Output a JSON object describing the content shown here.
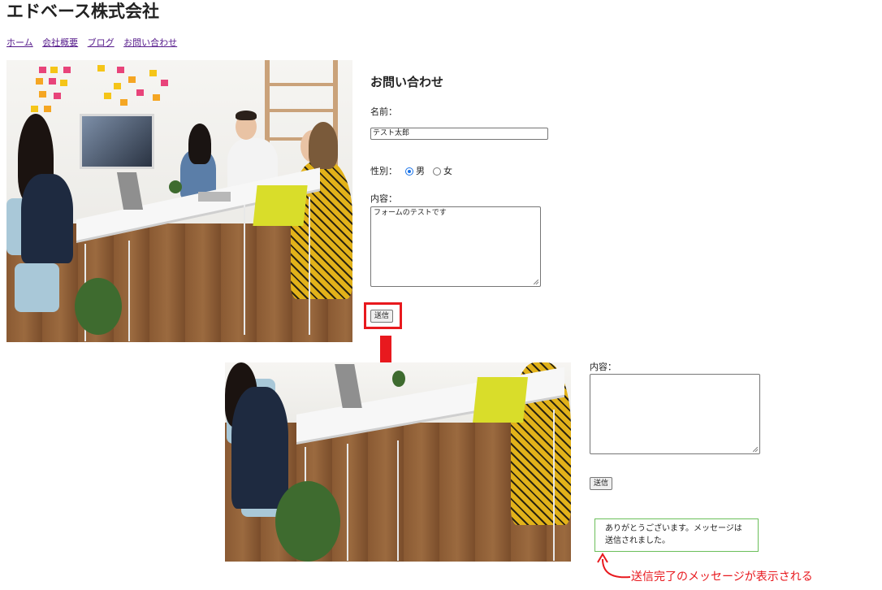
{
  "site": {
    "title": "エドベース株式会社",
    "nav": [
      "ホーム",
      "会社概要",
      "ブログ",
      "お問い合わせ"
    ]
  },
  "form": {
    "title": "お問い合わせ",
    "name_label": "名前：",
    "name_value": "テスト太郎",
    "gender_label": "性別：",
    "gender_options": [
      "男",
      "女"
    ],
    "gender_selected": "男",
    "content_label": "内容：",
    "content_value": "フォームのテストです",
    "submit_label": "送信"
  },
  "after": {
    "content_label": "内容：",
    "content_value": "",
    "submit_label": "送信",
    "success_message": "ありがとうございます。メッセージは送信されました。"
  },
  "annotation": {
    "text": "送信完了のメッセージが表示される",
    "color": "#e8191e"
  },
  "colors": {
    "highlight": "#e8191e",
    "success_border": "#6bbf5a",
    "link": "#551a8b"
  }
}
